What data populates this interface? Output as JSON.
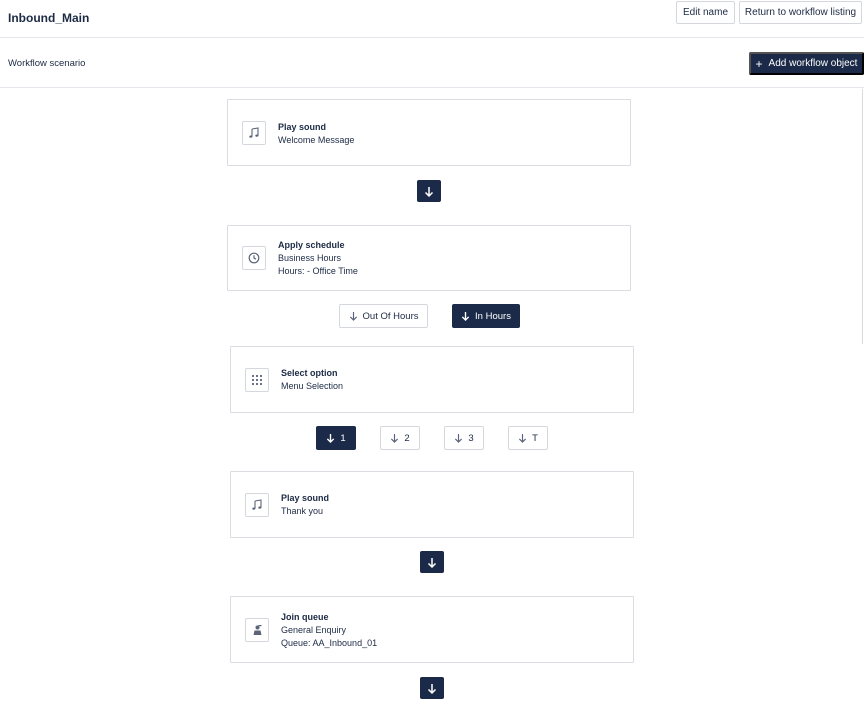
{
  "header": {
    "title": "Inbound_Main",
    "edit_name_label": "Edit name",
    "return_label": "Return to workflow listing"
  },
  "subheader": {
    "title": "Workflow scenario",
    "add_button_label": "Add workflow object"
  },
  "colors": {
    "primary": "#1b2a48",
    "border": "#d9dde2",
    "text": "#1c2a44"
  },
  "workflow": {
    "node1": {
      "icon": "music-note-icon",
      "heading": "Play sound",
      "line1": "Welcome Message"
    },
    "node2": {
      "icon": "clock-icon",
      "heading": "Apply schedule",
      "line1": "Business Hours",
      "line2": "Hours: - Office Time"
    },
    "schedule_branches": {
      "out_of_hours": "Out Of Hours",
      "in_hours": "In Hours"
    },
    "node3": {
      "icon": "keypad-icon",
      "heading": "Select option",
      "line1": "Menu Selection"
    },
    "option_branches": {
      "opt1": "1",
      "opt2": "2",
      "opt3": "3",
      "optT": "T"
    },
    "node4": {
      "icon": "music-note-icon",
      "heading": "Play sound",
      "line1": "Thank you"
    },
    "node5": {
      "icon": "queue-agent-icon",
      "heading": "Join queue",
      "line1": "General Enquiry",
      "line2": "Queue: AA_Inbound_01"
    }
  }
}
